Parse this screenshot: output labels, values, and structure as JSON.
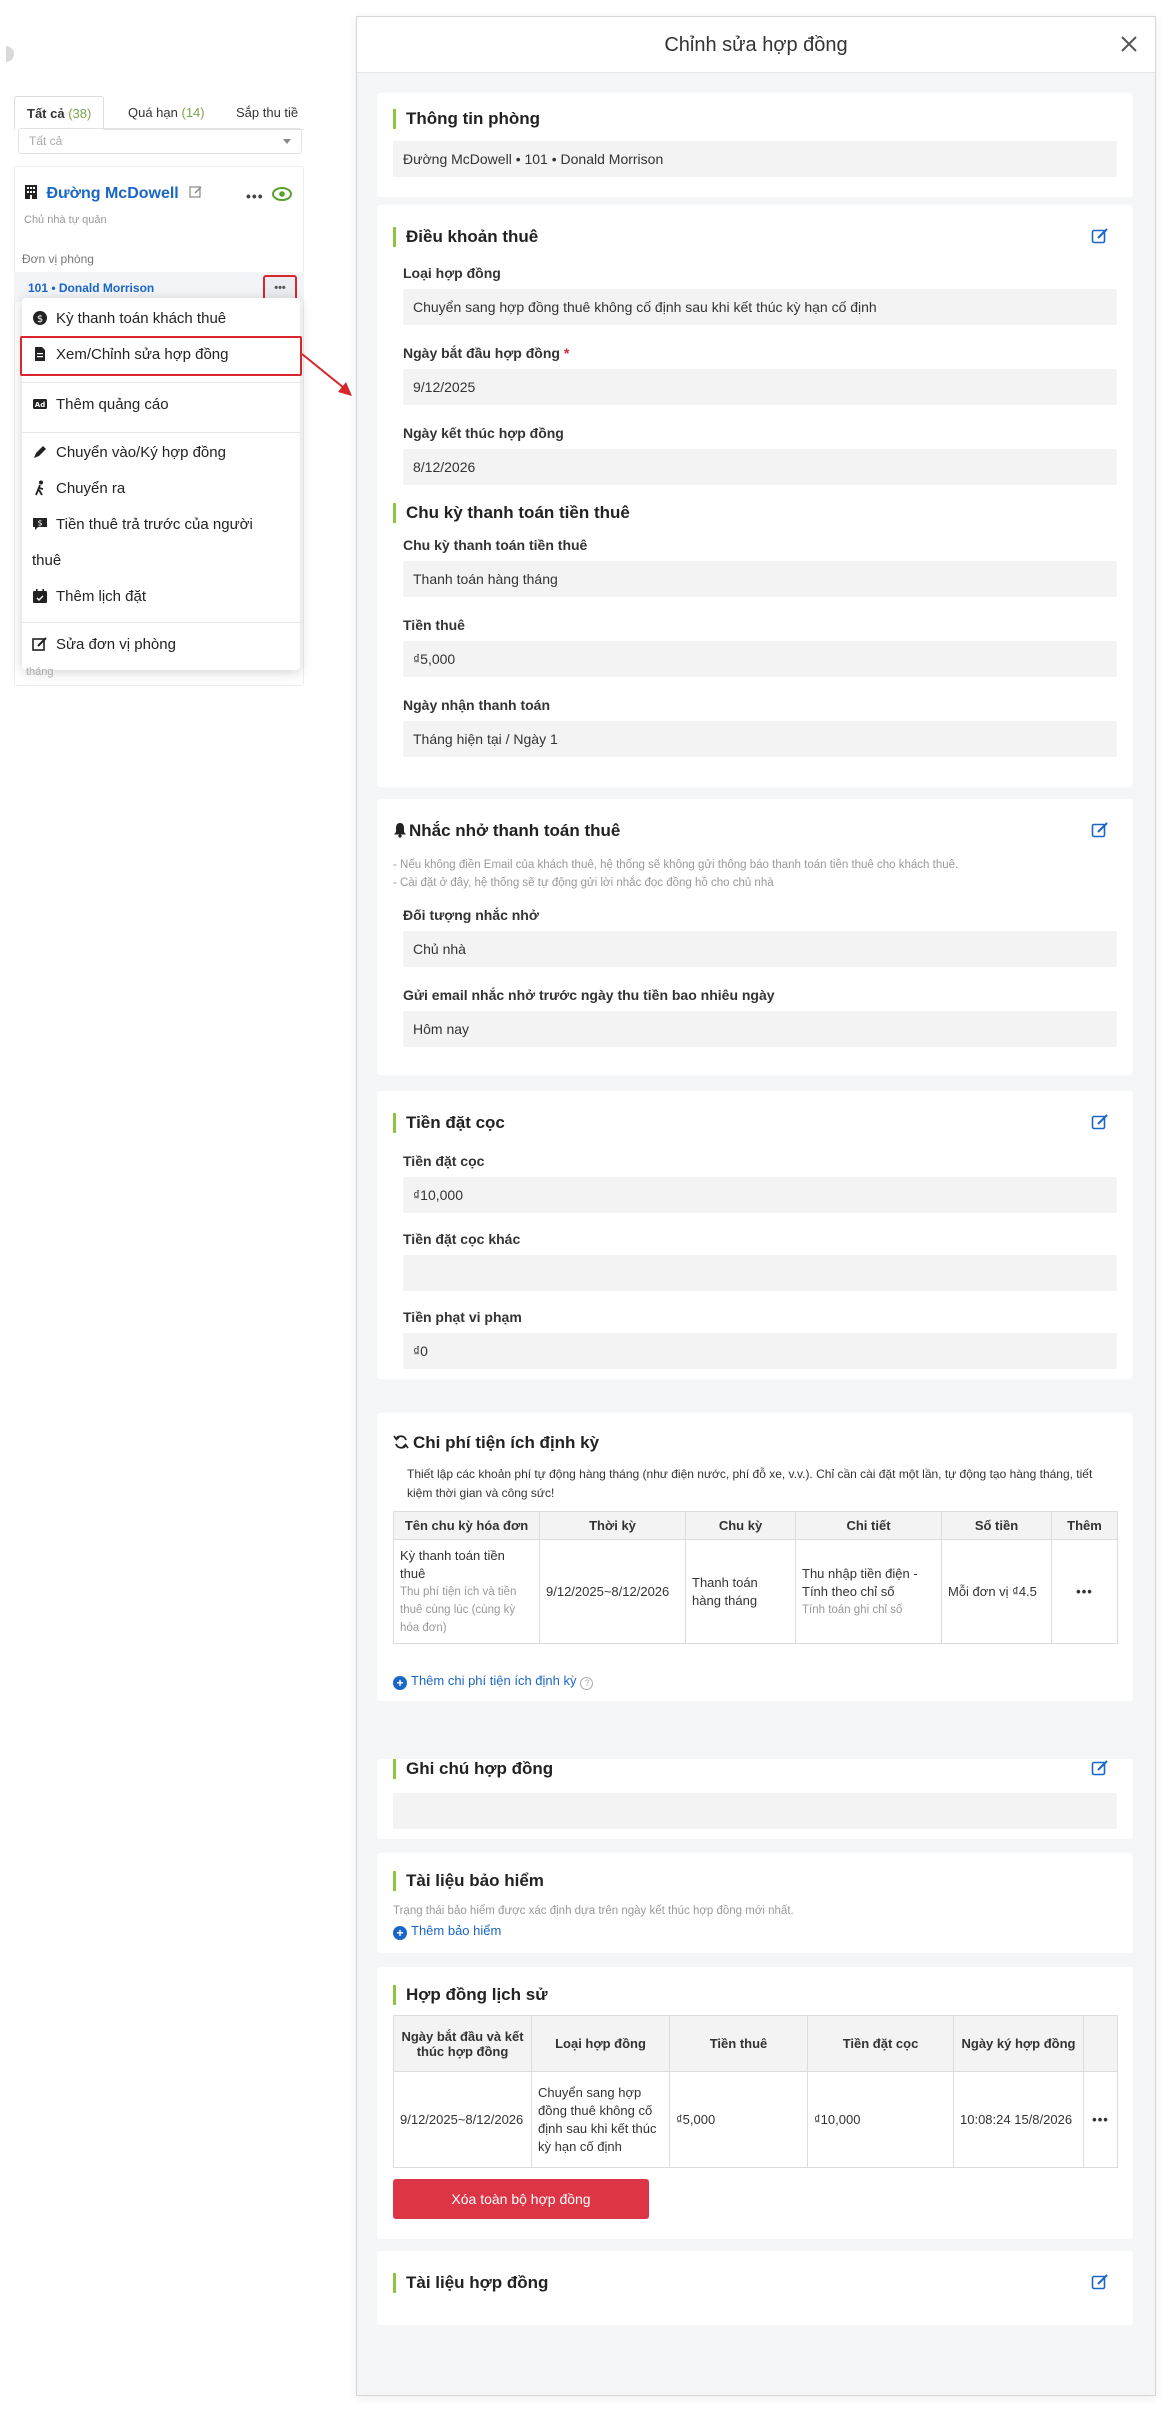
{
  "left_panel": {
    "tabs": [
      {
        "label": "Tất cả",
        "count": "(38)"
      },
      {
        "label": "Quá hạn",
        "count": "(14)"
      },
      {
        "label": "Sắp thu tiề",
        "count": ""
      }
    ],
    "filter_value": "Tất cả",
    "building_name": "Đường McDowell",
    "building_sub": "Chủ nhà tự quản",
    "unit_section_label": "Đơn vị phòng",
    "unit_name": "101 • Donald Morrison",
    "faded_text": "tháng",
    "menu_items": [
      "Kỳ thanh toán khách thuê",
      "Xem/Chỉnh sửa hợp đồng",
      "Thêm quảng cáo",
      "Chuyển vào/Ký hợp đồng",
      "Chuyển ra",
      "Tiền thuê trả trước của người",
      "thuê",
      "Thêm lịch đặt",
      "Sửa đơn vị phòng"
    ]
  },
  "dialog": {
    "title": "Chỉnh sửa hợp đồng",
    "room_info": {
      "title": "Thông tin phòng",
      "value": "Đường McDowell • 101 • Donald Morrison"
    },
    "lease_terms": {
      "title": "Điều khoản thuê",
      "contract_type_label": "Loại hợp đồng",
      "contract_type_value": "Chuyển sang hợp đồng thuê không cố định sau khi kết thúc kỳ hạn cố định",
      "start_label": "Ngày bắt đầu hợp đồng",
      "required_mark": "*",
      "start_value": "9/12/2025",
      "end_label": "Ngày kết thúc hợp đồng",
      "end_value": "8/12/2026",
      "cycle_title": "Chu kỳ thanh toán tiền thuê",
      "cycle_label": "Chu kỳ thanh toán tiền thuê",
      "cycle_value": "Thanh toán hàng tháng",
      "rent_label": "Tiền thuê",
      "rent_value": "₫5,000",
      "pay_day_label": "Ngày nhận thanh toán",
      "pay_day_value": "Tháng hiện tại / Ngày 1"
    },
    "reminder": {
      "title": "Nhắc nhở thanh toán thuê",
      "note1": "- Nếu không điền Email của khách thuê, hệ thống sẽ không gửi thông báo thanh toán tiền thuê cho khách thuê.",
      "note2": "- Cài đặt ở đây, hệ thống sẽ tự động gửi lời nhắc đọc đồng hồ cho chủ nhà",
      "target_label": "Đối tượng nhắc nhở",
      "target_value": "Chủ nhà",
      "days_label": "Gửi email nhắc nhở trước ngày thu tiền bao nhiêu ngày",
      "days_value": "Hôm nay"
    },
    "deposit": {
      "title": "Tiền đặt cọc",
      "deposit_label": "Tiền đặt cọc",
      "deposit_value": "₫10,000",
      "other_label": "Tiền đặt cọc khác",
      "other_value": "",
      "penalty_label": "Tiền phạt vi phạm",
      "penalty_value": "₫0"
    },
    "utilities": {
      "title": "Chi phí tiện ích định kỳ",
      "desc": "Thiết lập các khoản phí tự động hàng tháng (như điện nước, phí đỗ xe, v.v.). Chỉ cần cài đặt một lần, tự động tạo hàng tháng, tiết kiệm thời gian và công sức!",
      "columns": [
        "Tên chu kỳ hóa đơn",
        "Thời kỳ",
        "Chu kỳ",
        "Chi tiết",
        "Số tiền",
        "Thêm"
      ],
      "row": {
        "name": "Kỳ thanh toán tiền thuê",
        "name_sub": "Thu phí tiện ích và tiền thuê cùng lúc (cùng kỳ hóa đơn)",
        "period": "9/12/2025~8/12/2026",
        "cycle": "Thanh toán hàng tháng",
        "detail": "Thu nhập tiền điện - Tính theo chỉ số",
        "detail_sub": "Tính toán ghi chỉ số",
        "amount": "Mỗi đơn vị ₫4.5",
        "more": "•••"
      },
      "add_link": "Thêm chi phí tiện ích định kỳ"
    },
    "notes": {
      "title": "Ghi chú hợp đồng",
      "value": ""
    },
    "insurance": {
      "title": "Tài liệu bảo hiểm",
      "note": "Trạng thái bảo hiểm được xác định dựa trên ngày kết thúc hợp đồng mới nhất.",
      "add_link": "Thêm bảo hiểm"
    },
    "history": {
      "title": "Hợp đồng lịch sử",
      "columns": [
        "Ngày bắt đầu và kết thúc hợp đồng",
        "Loại hợp đồng",
        "Tiền thuê",
        "Tiền đặt cọc",
        "Ngày ký hợp đồng",
        ""
      ],
      "row": {
        "dates": "9/12/2025~8/12/2026",
        "type": "Chuyển sang hợp đồng thuê không cố định sau khi kết thúc kỳ hạn cố định",
        "rent": "₫5,000",
        "deposit": "₫10,000",
        "signed": "10:08:24 15/8/2026",
        "more": "•••"
      },
      "delete_button": "Xóa toàn bộ hợp đồng"
    },
    "documents": {
      "title": "Tài liệu hợp đồng"
    }
  },
  "colors": {
    "accent_green": "#8cc63f",
    "link_blue": "#1a66c7",
    "danger_red": "#dc3545",
    "highlight_red": "#d8262c"
  }
}
